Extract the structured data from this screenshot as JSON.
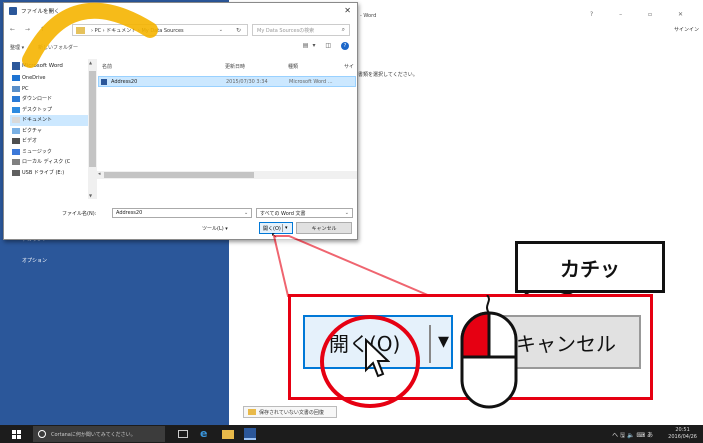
{
  "word": {
    "title_suffix": "- Word",
    "window_controls": "?  –  ▫  ✕",
    "signin": "サインイン",
    "notice": "書類を選択してください。",
    "account": "アカウント",
    "options": "オプション",
    "unsaved_docs": "保存されていない文書の回復"
  },
  "dialog": {
    "title": "ファイルを開く",
    "nav_arrows": "← → ↑",
    "breadcrumb": "› PC › ドキュメント › My Data Sources",
    "search_placeholder": "My Data Sourcesの検索",
    "organize": "整理 ▾",
    "new_folder": "新しいフォルダー",
    "help": "?",
    "nav_items": [
      {
        "label": "Microsoft Word",
        "color": "#2b579a"
      },
      {
        "label": "OneDrive",
        "color": "#1e73d2"
      },
      {
        "label": "PC",
        "color": "#5a8fc9"
      },
      {
        "label": "ダウンロード",
        "color": "#2a7ad6"
      },
      {
        "label": "デスクトップ",
        "color": "#2d8be0"
      },
      {
        "label": "ドキュメント",
        "color": "#d9d9d9"
      },
      {
        "label": "ピクチャ",
        "color": "#7ab0e3"
      },
      {
        "label": "ビデオ",
        "color": "#4f4f4f"
      },
      {
        "label": "ミュージック",
        "color": "#3c78d8"
      },
      {
        "label": "ローカル ディスク (C",
        "color": "#808080"
      },
      {
        "label": "USB ドライブ (E:)",
        "color": "#606060"
      }
    ],
    "columns": {
      "name": "名前",
      "date": "更新日時",
      "type": "種類",
      "size": "サイ"
    },
    "file": {
      "name": "Address20",
      "date": "2015/07/30 3:34",
      "type": "Microsoft Word ..."
    },
    "filename_label": "ファイル名(N):",
    "filename_value": "Address20",
    "filetype_value": "すべての Word 文書",
    "tools_label": "ツール(L) ▾",
    "open_label": "開く(O)",
    "cancel_label": "キャンセル"
  },
  "zoom": {
    "open_label": "開く(O)",
    "cancel_label": "キャンセル",
    "sound": "カチッ"
  },
  "taskbar": {
    "cortana": "Cortanaに何か聞いてみてください。",
    "tray": "へ 🖫 🔈 ⌨ あ",
    "time": "20:51",
    "date": "2016/04/26"
  }
}
